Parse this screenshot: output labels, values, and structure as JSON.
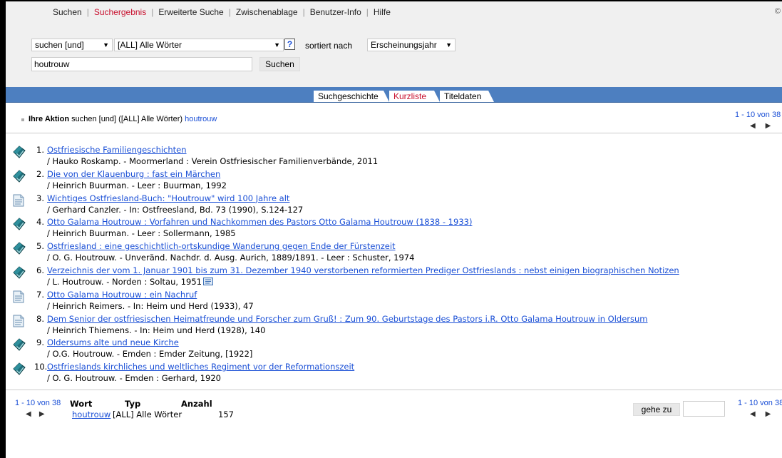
{
  "nav": {
    "items": [
      {
        "label": "Suchen"
      },
      {
        "label": "Suchergebnis"
      },
      {
        "label": "Erweiterte Suche"
      },
      {
        "label": "Zwischenablage"
      },
      {
        "label": "Benutzer-Info"
      },
      {
        "label": "Hilfe"
      }
    ],
    "active_index": 1,
    "corner_mark": "©"
  },
  "search": {
    "mode": "suchen [und]",
    "field": "[ALL] Alle Wörter",
    "help": "?",
    "sort_label": "sortiert nach",
    "sort_value": "Erscheinungsjahr",
    "query": "houtrouw",
    "button": "Suchen"
  },
  "tabs": {
    "history": "Suchgeschichte",
    "short_list": "Kurzliste",
    "title_data": "Titeldaten"
  },
  "action": {
    "label": "Ihre Aktion",
    "text": "suchen [und] ([ALL] Alle Wörter)",
    "term": "houtrouw"
  },
  "pager": {
    "range": "1 - 10 von 38",
    "prev": "◀",
    "next": "▶"
  },
  "results": [
    {
      "num": "1.",
      "icon": "book-icon",
      "title": "Ostfriesische Familiengeschichten",
      "meta": "/ Hauko Roskamp. - Moormerland : Verein Ostfriesischer Familienverbände, 2011"
    },
    {
      "num": "2.",
      "icon": "book-icon",
      "title": "Die von der Klauenburg : fast ein Märchen",
      "meta": "/ Heinrich Buurman. - Leer : Buurman, 1992"
    },
    {
      "num": "3.",
      "icon": "article-icon",
      "title": "Wichtiges Ostfriesland-Buch: \"Houtrouw\" wird 100 Jahre alt",
      "meta": "/ Gerhard Canzler. - In: Ostfreesland, Bd. 73 (1990), S.124-127"
    },
    {
      "num": "4.",
      "icon": "book-icon",
      "title": "Otto Galama Houtrouw : Vorfahren und Nachkommen des Pastors Otto Galama Houtrouw (1838 - 1933)",
      "meta": "/ Heinrich Buurman. - Leer : Sollermann, 1985"
    },
    {
      "num": "5.",
      "icon": "book-icon",
      "title": "Ostfriesland : eine geschichtlich-ortskundige Wanderung gegen Ende der Fürstenzeit",
      "meta": "/ O. G. Houtrouw. - Unveränd. Nachdr. d. Ausg. Aurich, 1889/1891. - Leer : Schuster, 1974"
    },
    {
      "num": "6.",
      "icon": "book-icon",
      "title": "Verzeichnis der vom 1. Januar 1901 bis zum 31. Dezember 1940 verstorbenen reformierten Prediger Ostfrieslands : nebst einigen biographischen Notizen",
      "meta": "/ L. Houtrouw. - Norden : Soltau, 1951",
      "extra_icon": "digital-copy-icon"
    },
    {
      "num": "7.",
      "icon": "article-icon",
      "title": "Otto Galama Houtrouw : ein Nachruf",
      "meta": "/ Heinrich Reimers. - In: Heim und Herd (1933), 47"
    },
    {
      "num": "8.",
      "icon": "article-icon",
      "title": "Dem Senior der ostfriesischen Heimatfreunde und Forscher zum Gruß! : Zum 90. Geburtstage des Pastors i.R. Otto Galama Houtrouw in Oldersum",
      "meta": "/ Heinrich Thiemens. - In: Heim und Herd (1928), 140"
    },
    {
      "num": "9.",
      "icon": "book-icon",
      "title": "Oldersums alte und neue Kirche",
      "meta": "/ O.G. Houtrouw. - Emden : Emder Zeitung, [1922]"
    },
    {
      "num": "10.",
      "icon": "book-icon",
      "title": "Ostfrieslands kirchliches und weltliches Regiment vor der Reformationszeit",
      "meta": "/ O. G. Houtrouw. - Emden : Gerhard, 1920"
    }
  ],
  "stats": {
    "headers": {
      "word": "Wort",
      "type": "Typ",
      "count": "Anzahl"
    },
    "row": {
      "word": "houtrouw",
      "type": "[ALL] Alle Wörter",
      "count": "157"
    }
  },
  "goto": {
    "label": "gehe zu",
    "value": ""
  }
}
